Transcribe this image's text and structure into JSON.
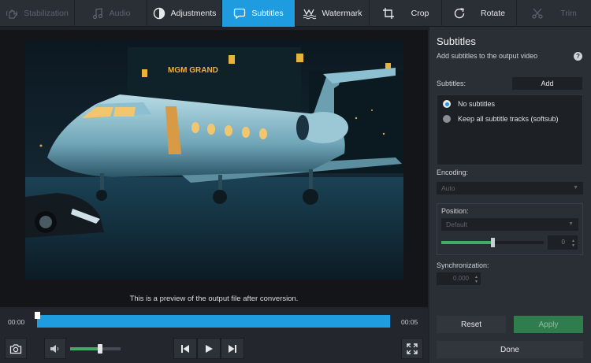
{
  "toolbar": {
    "tabs": [
      {
        "label": "Stabilization",
        "icon": "stabilization-icon",
        "state": "disabled"
      },
      {
        "label": "Audio",
        "icon": "music-note-icon",
        "state": "disabled"
      },
      {
        "label": "Adjustments",
        "icon": "adjustments-icon",
        "state": "normal"
      },
      {
        "label": "Subtitles",
        "icon": "speech-bubble-icon",
        "state": "active"
      },
      {
        "label": "Watermark",
        "icon": "watermark-icon",
        "state": "normal"
      },
      {
        "label": "Crop",
        "icon": "crop-icon",
        "state": "normal"
      },
      {
        "label": "Rotate",
        "icon": "rotate-icon",
        "state": "normal"
      },
      {
        "label": "Trim",
        "icon": "scissors-icon",
        "state": "disabled"
      }
    ]
  },
  "video": {
    "sign_text": "MGM GRAND",
    "preview_caption": "This is a preview of the output file after conversion."
  },
  "timeline": {
    "start_time": "00:00",
    "end_time": "00:05",
    "progress_fraction": 1.0
  },
  "controls": {
    "volume_fraction": 0.6,
    "icons": [
      "camera-icon",
      "speaker-icon",
      "skip-back-icon",
      "play-icon",
      "skip-forward-icon",
      "fullscreen-icon"
    ]
  },
  "panel": {
    "title": "Subtitles",
    "subtitle": "Add subtitles to the output video",
    "help": "?",
    "subtitles_label": "Subtitles:",
    "add_label": "Add",
    "options": [
      {
        "label": "No subtitles",
        "selected": true
      },
      {
        "label": "Keep all subtitle tracks (softsub)",
        "selected": false
      }
    ],
    "encoding_label": "Encoding:",
    "encoding_value": "Auto",
    "position_label": "Position:",
    "position_value": "Default",
    "position_slider_fraction": 0.5,
    "position_number": "0",
    "sync_label": "Synchronization:",
    "sync_value": "0.000",
    "reset_label": "Reset",
    "apply_label": "Apply",
    "done_label": "Done"
  },
  "colors": {
    "accent": "#1f9be0",
    "green": "#3fae64",
    "apply_green": "#2f7d4c"
  }
}
